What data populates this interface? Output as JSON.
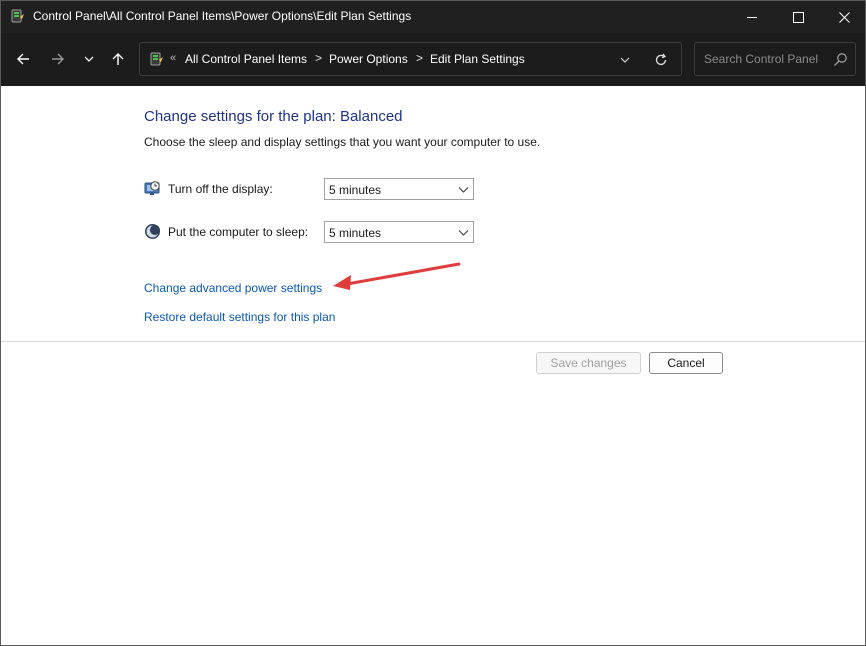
{
  "window": {
    "title": "Control Panel\\All Control Panel Items\\Power Options\\Edit Plan Settings"
  },
  "address": {
    "overflow_chevron": "«",
    "crumbs": [
      "All Control Panel Items",
      "Power Options",
      "Edit Plan Settings"
    ],
    "separator": ">"
  },
  "search": {
    "placeholder": "Search Control Panel"
  },
  "main": {
    "heading": "Change settings for the plan: Balanced",
    "subtext": "Choose the sleep and display settings that you want your computer to use.",
    "settings": [
      {
        "label": "Turn off the display:",
        "value": "5 minutes",
        "icon": "monitor-clock-icon"
      },
      {
        "label": "Put the computer to sleep:",
        "value": "5 minutes",
        "icon": "moon-sleep-icon"
      }
    ],
    "links": {
      "advanced": "Change advanced power settings",
      "restore": "Restore default settings for this plan"
    },
    "buttons": {
      "save": "Save changes",
      "cancel": "Cancel"
    }
  },
  "colors": {
    "titlebar_bg": "#202020",
    "heading": "#1e3287",
    "link": "#0a58b8",
    "annotation_arrow": "#e03c3c"
  }
}
